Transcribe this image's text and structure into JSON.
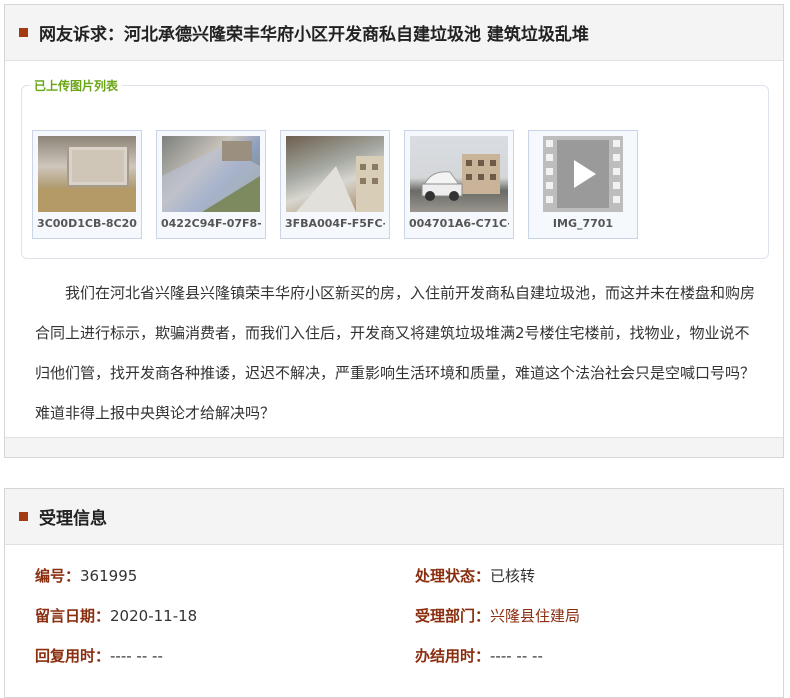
{
  "complaint": {
    "title": "网友诉求：河北承德兴隆荣丰华府小区开发商私自建垃圾池 建筑垃圾乱堆",
    "gallery_label": "已上传图片列表",
    "attachments": [
      {
        "caption": "3C00D1CB-8C20",
        "kind": "photo"
      },
      {
        "caption": "0422C94F-07F8-",
        "kind": "photo"
      },
      {
        "caption": "3FBA004F-F5FC-",
        "kind": "photo"
      },
      {
        "caption": "004701A6-C71C-",
        "kind": "photo"
      },
      {
        "caption": "IMG_7701",
        "kind": "video",
        "icon": "video-play-icon"
      }
    ],
    "body": "我们在河北省兴隆县兴隆镇荣丰华府小区新买的房，入住前开发商私自建垃圾池，而这并未在楼盘和购房合同上进行标示，欺骗消费者，而我们入住后，开发商又将建筑垃圾堆满2号楼住宅楼前，找物业，物业说不归他们管，找开发商各种推诿，迟迟不解决，严重影响生活环境和质量，难道这个法治社会只是空喊口号吗？难道非得上报中央舆论才给解决吗？"
  },
  "acceptance": {
    "title": "受理信息",
    "id_label": "编号：",
    "id_value": "361995",
    "status_label": "处理状态：",
    "status_value": "已核转",
    "date_label": "留言日期：",
    "date_value": "2020-11-18",
    "dept_label": "受理部门：",
    "dept_value": "兴隆县住建局",
    "reply_time_label": "回复用时：",
    "reply_time_value": "---- -- --",
    "finish_time_label": "办结用时：",
    "finish_time_value": "---- -- --"
  },
  "colors": {
    "accent": "#a33a12",
    "label_red": "#8a2e0f",
    "legend_green": "#6aa516"
  }
}
